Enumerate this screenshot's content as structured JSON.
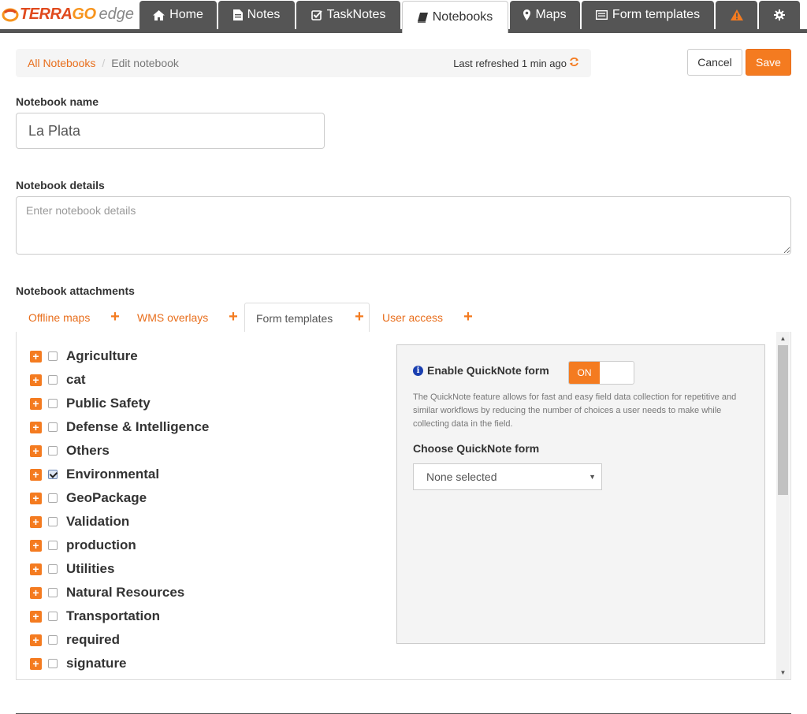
{
  "app": {
    "logo": {
      "terra": "TERRA",
      "go": "GO",
      "edge": "edge"
    },
    "nav": [
      {
        "label": "Home",
        "icon": "home-icon"
      },
      {
        "label": "Notes",
        "icon": "file-icon"
      },
      {
        "label": "TaskNotes",
        "icon": "checkbox-icon"
      },
      {
        "label": "Notebooks",
        "icon": "book-icon",
        "active": true
      },
      {
        "label": "Maps",
        "icon": "map-marker-icon"
      },
      {
        "label": "Form templates",
        "icon": "list-icon"
      },
      {
        "label": "",
        "icon": "warning-icon"
      },
      {
        "label": "",
        "icon": "gear-icon"
      }
    ]
  },
  "breadcrumb": {
    "root": "All Notebooks",
    "separator": "/",
    "current": "Edit notebook",
    "refresh": "Last refreshed 1 min ago"
  },
  "actions": {
    "cancel": "Cancel",
    "save": "Save"
  },
  "form": {
    "name_label": "Notebook name",
    "name_value": "La Plata",
    "details_label": "Notebook details",
    "details_placeholder": "Enter notebook details",
    "attachments_label": "Notebook attachments"
  },
  "attachment_tabs": [
    {
      "label": "Offline maps"
    },
    {
      "label": "WMS overlays"
    },
    {
      "label": "Form templates",
      "active": true
    },
    {
      "label": "User access"
    }
  ],
  "templates": [
    {
      "label": "Agriculture",
      "checked": false
    },
    {
      "label": "cat",
      "checked": false
    },
    {
      "label": "Public Safety",
      "checked": false
    },
    {
      "label": "Defense & Intelligence",
      "checked": false
    },
    {
      "label": "Others",
      "checked": false
    },
    {
      "label": "Environmental",
      "checked": true
    },
    {
      "label": "GeoPackage",
      "checked": false
    },
    {
      "label": "Validation",
      "checked": false
    },
    {
      "label": "production",
      "checked": false
    },
    {
      "label": "Utilities",
      "checked": false
    },
    {
      "label": "Natural Resources",
      "checked": false
    },
    {
      "label": "Transportation",
      "checked": false
    },
    {
      "label": "required",
      "checked": false
    },
    {
      "label": "signature",
      "checked": false
    }
  ],
  "quicknote": {
    "title": "Enable QuickNote form",
    "toggle": "ON",
    "description": "The QuickNote feature allows for fast and easy field data collection for repetitive and similar workflows by reducing the number of choices a user needs to make while collecting data in the field.",
    "choose_label": "Choose QuickNote form",
    "select_value": "None selected"
  },
  "colors": {
    "accent": "#f47b20",
    "nav_bg": "#555555",
    "link": "#e86e1c"
  }
}
